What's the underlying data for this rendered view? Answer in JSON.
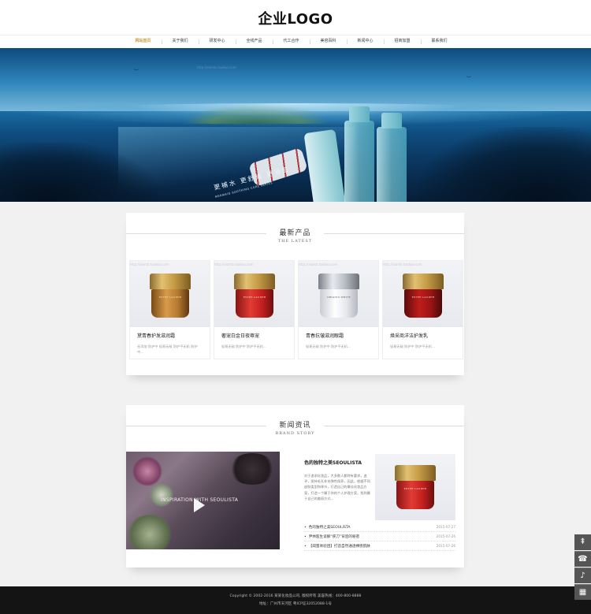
{
  "header": {
    "logo": "企业LOGO"
  },
  "nav": {
    "items": [
      "网站首页",
      "关于我们",
      "研发中心",
      "全线产品",
      "代工合作",
      "美容百科",
      "新闻中心",
      "招商加盟",
      "联系我们"
    ],
    "active_index": 0,
    "active_color": "#c9a045"
  },
  "banner": {
    "slogan": "更補水 更舒緩 更治愈",
    "sub": "MERMAID SOOTHING CURE SERIES",
    "watermark": "http://alamb.taobao.com",
    "slides": 3,
    "active_slide": 0
  },
  "latest": {
    "title_zh": "最新产品",
    "title_en": "THE LATEST",
    "products": [
      {
        "name": "黛青春护发滋润霜",
        "desc": "无添加 防护中 轻易无敌 防护平无机 防护中...",
        "brand": "ESTEE LAUDER",
        "lid": "gold",
        "body": "amber"
      },
      {
        "name": "奢宠白金日夜尊宠",
        "desc": "轻易无敌 防护中 防护平无机...",
        "brand": "ESTEE LAUDER",
        "lid": "gold",
        "body": "red"
      },
      {
        "name": "青春抗皱滋润眼霜",
        "desc": "轻易无敌 防护中 防护平无机...",
        "brand": "ORIGINS WHITE",
        "lid": "silver",
        "body": "white"
      },
      {
        "name": "焕采商洋洁护发乳",
        "desc": "轻易无敌 防护中 防护平无机...",
        "brand": "ESTEE LAUDER",
        "lid": "gold",
        "body": "deep"
      }
    ],
    "watermark": "http://alamb.taobao.com"
  },
  "news": {
    "title_zh": "新闻资讯",
    "title_en": "BRAND STORY",
    "video_text": "INSPIRATION WITH SEOULISTA",
    "featured_title": "色的独特之美SEOULISTA",
    "featured_body": "对于追求化妆品，大多数人都特有要求，追寻，保持毛孔补充弹性保养，因此，根据不同皮肤类型和季节，打造自己的最佳化妆品方案，打造一个属于你的个人护理方案，找到属于自己的美丽方式...",
    "featured_brand": "ESTEE LAUDER",
    "list": [
      {
        "title": "色的独特之美SEOULISTA",
        "date": "2015-07-27"
      },
      {
        "title": "尹林医生谈解“侠刀”背后的秘密",
        "date": "2015-07-26"
      },
      {
        "title": "【闺蜜体验团】打造自然通透裸感肌肤",
        "date": "2015-07-26"
      }
    ]
  },
  "footer": {
    "line1": "Copyright © 2002-2016 某某化妆品公司, 版权所有   美容热线：400-800-8888",
    "line2": "地址：广州市天河区     粤ICP证32052088-1号"
  },
  "side_tools": [
    {
      "icon": "top-icon",
      "glyph": "⇞"
    },
    {
      "icon": "phone-icon",
      "glyph": "☎"
    },
    {
      "icon": "bell-icon",
      "glyph": "♪"
    },
    {
      "icon": "qrcode-icon",
      "glyph": "▦"
    }
  ]
}
